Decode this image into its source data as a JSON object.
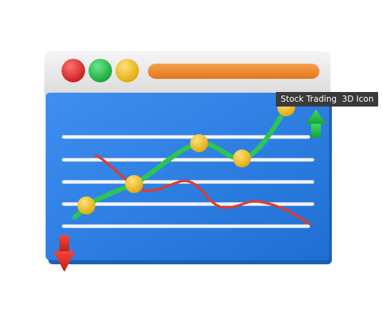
{
  "tooltip": {
    "text": "Stock Trading  3D Icon"
  },
  "icon": {
    "subject": "browser-window-stock-chart",
    "window_lights": [
      {
        "name": "red-light",
        "color": "#e02a2a"
      },
      {
        "name": "green-light",
        "color": "#22c24a"
      },
      {
        "name": "yellow-light",
        "color": "#f2c31a"
      }
    ],
    "colors": {
      "window_frame": "#ebebeb",
      "address_bar": "#f08a2c",
      "screen": "#2f7fe0",
      "grid_lines": "#f4f4f4",
      "rising_line": "#2ec455",
      "falling_line": "#e23a2e",
      "data_points": "#f4c21c",
      "up_arrow": "#1fbf4a",
      "down_arrow": "#e52a22"
    }
  }
}
